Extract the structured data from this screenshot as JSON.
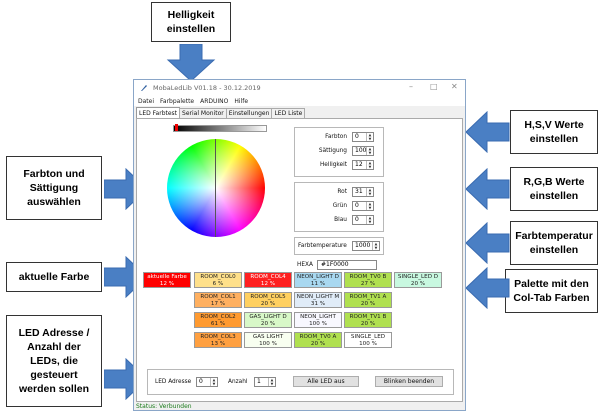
{
  "callouts": {
    "brightness": "Helligkeit einstellen",
    "hue_sat": "Farbton und Sättigung auswählen",
    "current_color": "aktuelle Farbe",
    "led_address": "LED Adresse / Anzahl der LEDs, die gesteuert werden sollen",
    "hsv": "H,S,V Werte einstellen",
    "rgb": "R,G,B Werte einstellen",
    "temperature": "Farbtemperatur einstellen",
    "palette": "Palette mit den Col-Tab Farben"
  },
  "window": {
    "title": "MobaLedLib V01.18 - 30.12.2019",
    "menu": [
      "Datei",
      "Farbpalette",
      "ARDUINO",
      "Hilfe"
    ],
    "tabs": [
      "LED Farbtest",
      "Serial Monitor",
      "Einstellungen",
      "LED Liste"
    ],
    "active_tab": 0
  },
  "hsv": {
    "hue_label": "Farbton",
    "hue_value": "0",
    "sat_label": "Sättigung",
    "sat_value": "100",
    "val_label": "Helligkeit",
    "val_value": "12"
  },
  "rgb": {
    "r_label": "Rot",
    "r_value": "31",
    "g_label": "Grün",
    "g_value": "0",
    "b_label": "Blau",
    "b_value": "0"
  },
  "temperature": {
    "label": "Farbtemperature",
    "value": "1000"
  },
  "hex": {
    "label": "HEXA",
    "value": "#1F0000"
  },
  "palette": [
    [
      {
        "name": "aktuelle Farbe",
        "pct": "12 %",
        "color": "#ff0000",
        "text_color": "#ffffff"
      },
      {
        "name": "ROOM_COL0",
        "pct": "6 %",
        "color": "#ffe08a",
        "text_color": "#222222"
      },
      {
        "name": "ROOM_COL4",
        "pct": "12 %",
        "color": "#ff2020",
        "text_color": "#ffffff"
      },
      {
        "name": "NEON_LIGHT D",
        "pct": "11 %",
        "color": "#a8d8f0",
        "text_color": "#222222"
      },
      {
        "name": "ROOM_TV0 B",
        "pct": "27 %",
        "color": "#b0e050",
        "text_color": "#222222"
      },
      {
        "name": "SINGLE_LED D",
        "pct": "20 %",
        "color": "#c8f8e0",
        "text_color": "#222222"
      }
    ],
    [
      {
        "name": "ROOM_COL1",
        "pct": "17 %",
        "color": "#ffb060",
        "text_color": "#222222"
      },
      {
        "name": "ROOM_COL5",
        "pct": "20 %",
        "color": "#ffd060",
        "text_color": "#222222"
      },
      {
        "name": "NEON_LIGHT M",
        "pct": "31 %",
        "color": "#e0ecf8",
        "text_color": "#222222"
      },
      {
        "name": "ROOM_TV1 A",
        "pct": "20 %",
        "color": "#b0e050",
        "text_color": "#222222"
      }
    ],
    [
      {
        "name": "ROOM_COL2",
        "pct": "61 %",
        "color": "#ff9a30",
        "text_color": "#222222"
      },
      {
        "name": "GAS_LIGHT D",
        "pct": "20 %",
        "color": "#d8f8c8",
        "text_color": "#222222"
      },
      {
        "name": "NEON_LIGHT",
        "pct": "100 %",
        "color": "#f8f8ff",
        "text_color": "#222222"
      },
      {
        "name": "ROOM_TV1 B",
        "pct": "20 %",
        "color": "#b0e050",
        "text_color": "#222222"
      }
    ],
    [
      {
        "name": "ROOM_COL3",
        "pct": "13 %",
        "color": "#ffa040",
        "text_color": "#222222"
      },
      {
        "name": "GAS LIGHT",
        "pct": "100 %",
        "color": "#f8fff0",
        "text_color": "#222222"
      },
      {
        "name": "ROOM_TV0 A",
        "pct": "20 %",
        "color": "#b0e050",
        "text_color": "#222222"
      },
      {
        "name": "SINGLE_LED",
        "pct": "100 %",
        "color": "#ffffff",
        "text_color": "#222222"
      }
    ]
  ],
  "bottom": {
    "addr_label": "LED Adresse",
    "addr_value": "0",
    "count_label": "Anzahl",
    "count_value": "1",
    "all_off": "Alle LED aus",
    "blink_stop": "Blinken beenden"
  },
  "status": "Status: Verbunden",
  "colors": {
    "arrow": "#4a7fc4",
    "arrow_edge": "#3a6bb0",
    "window_border": "#8aa6c8"
  }
}
